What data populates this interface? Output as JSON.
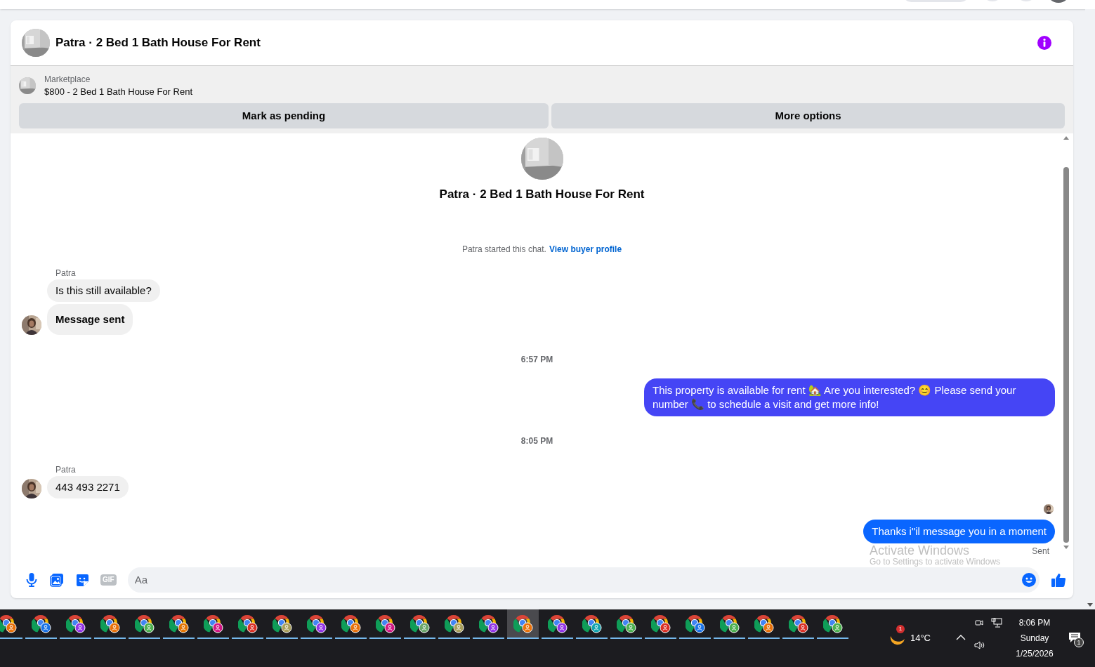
{
  "conversation": {
    "title": "Patra · 2 Bed 1 Bath House For Rent"
  },
  "listing": {
    "source": "Marketplace",
    "title": "$800 - 2 Bed 1 Bath House For Rent",
    "buttons": [
      "Mark as pending",
      "More options"
    ]
  },
  "chat_intro": {
    "title": "Patra · 2 Bed 1 Bath House For Rent",
    "started_text": "Patra started this chat.",
    "link": "View buyer profile"
  },
  "messages": [
    {
      "kind": "incoming",
      "sender": "Patra",
      "bubbles": [
        {
          "text": "Is this still available?",
          "bold": false
        },
        {
          "text": "Message sent",
          "bold": true
        }
      ]
    },
    {
      "kind": "time",
      "text": "6:57 PM"
    },
    {
      "kind": "outgoing",
      "color": "#4545f5",
      "bubbles": [
        {
          "text": "This property is available for rent 🏡 Are you interested? 😊 Please send your number 📞 to schedule a visit and get more info!"
        }
      ]
    },
    {
      "kind": "time",
      "text": "8:05 PM"
    },
    {
      "kind": "incoming",
      "sender": "Patra",
      "bubbles": [
        {
          "text": "443 493 2271",
          "bold": false
        }
      ]
    },
    {
      "kind": "outgoing",
      "color": "#0a66ff",
      "seen": true,
      "status": "Sent",
      "bubbles": [
        {
          "text": "Thanks i\"il message you in a moment"
        }
      ]
    }
  ],
  "composer": {
    "placeholder": "Aa",
    "gif_label": "GIF"
  },
  "os_notice": {
    "title": "Activate Windows",
    "subtitle": "Go to Settings to activate Windows"
  },
  "taskbar": {
    "apps": [
      {
        "color": "#e8710a",
        "selected": false
      },
      {
        "color": "#1a73e8",
        "selected": false
      },
      {
        "color": "#9334e6",
        "selected": false
      },
      {
        "color": "#e8710a",
        "selected": false
      },
      {
        "color": "#4caf50",
        "selected": false
      },
      {
        "color": "#e37400",
        "selected": false
      },
      {
        "color": "#d01884",
        "selected": false
      },
      {
        "color": "#d93025",
        "selected": false
      },
      {
        "color": "#a89f5c",
        "selected": false
      },
      {
        "color": "#9334e6",
        "selected": false
      },
      {
        "color": "#e8710a",
        "selected": false
      },
      {
        "color": "#d01884",
        "selected": false
      },
      {
        "color": "#6aa56a",
        "selected": false
      },
      {
        "color": "#a89f5c",
        "selected": false
      },
      {
        "color": "#9334e6",
        "selected": false
      },
      {
        "color": "#e8710a",
        "selected": true
      },
      {
        "color": "#9334e6",
        "selected": false
      },
      {
        "color": "#12a4af",
        "selected": false
      },
      {
        "color": "#4caf50",
        "selected": false
      },
      {
        "color": "#d93025",
        "selected": false
      },
      {
        "color": "#1a73e8",
        "selected": false
      },
      {
        "color": "#4caf50",
        "selected": false
      },
      {
        "color": "#e8710a",
        "selected": false
      },
      {
        "color": "#d93025",
        "selected": false
      },
      {
        "color": "#4caf50",
        "selected": false
      }
    ],
    "weather": {
      "temperature": "14°C",
      "badge": "1"
    },
    "clock": {
      "time": "8:06 PM",
      "day": "Sunday",
      "date": "1/25/2026"
    },
    "notifications": "1"
  }
}
